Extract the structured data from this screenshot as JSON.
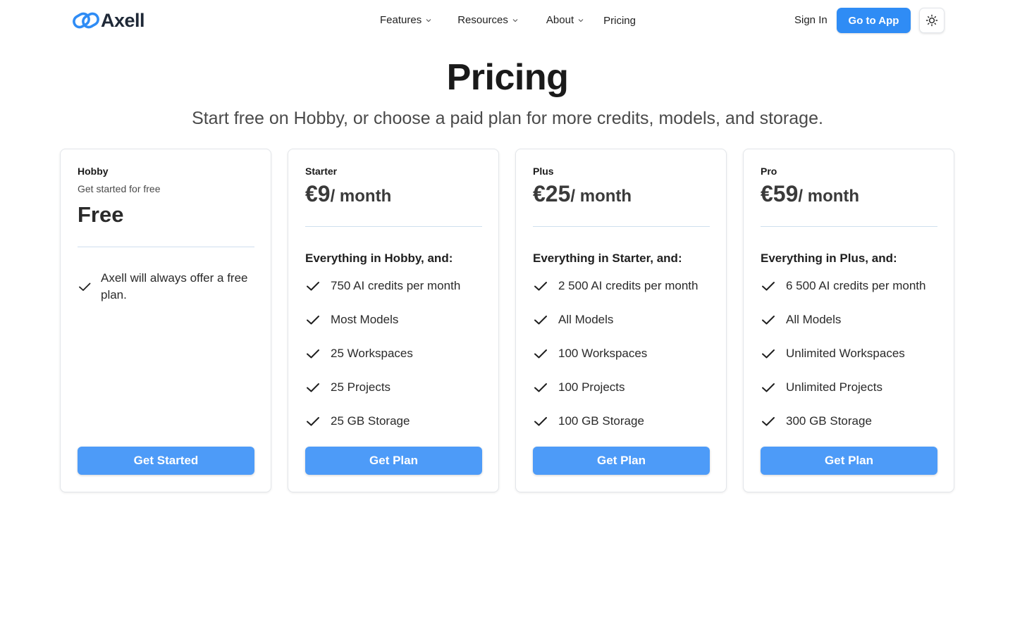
{
  "header": {
    "logo_text": "Axell",
    "logo_icon": "infinity-link-icon",
    "nav": [
      {
        "label": "Features",
        "has_dropdown": true
      },
      {
        "label": "Resources",
        "has_dropdown": true
      },
      {
        "label": "About",
        "has_dropdown": true
      },
      {
        "label": "Pricing",
        "has_dropdown": false
      }
    ],
    "sign_in_label": "Sign In",
    "go_to_app_label": "Go to App",
    "theme_icon": "sun-icon"
  },
  "hero": {
    "title": "Pricing",
    "subtitle": "Start free on Hobby, or choose a paid plan for more credits, models, and storage."
  },
  "plans": [
    {
      "name": "Hobby",
      "tagline": "Get started for free",
      "price_label": "Free",
      "features": [
        "Axell will always offer a free plan."
      ],
      "cta_label": "Get Started"
    },
    {
      "name": "Starter",
      "price_amount": "€9",
      "price_period": "/ month",
      "features_heading": "Everything in Hobby, and:",
      "features": [
        "750 AI credits per month",
        "Most Models",
        "25 Workspaces",
        "25 Projects",
        "25 GB Storage"
      ],
      "cta_label": "Get Plan"
    },
    {
      "name": "Plus",
      "price_amount": "€25",
      "price_period": "/ month",
      "features_heading": "Everything in Starter, and:",
      "features": [
        "2 500 AI credits per month",
        "All Models",
        "100 Workspaces",
        "100 Projects",
        "100 GB Storage"
      ],
      "cta_label": "Get Plan"
    },
    {
      "name": "Pro",
      "price_amount": "€59",
      "price_period": "/ month",
      "features_heading": "Everything in Plus, and:",
      "features": [
        "6 500 AI credits per month",
        "All Models",
        "Unlimited Workspaces",
        "Unlimited Projects",
        "300 GB Storage"
      ],
      "cta_label": "Get Plan"
    }
  ],
  "colors": {
    "primary_button": "#2f8cf5",
    "cta_button": "#4d9bf8",
    "logo_blue": "#2f8cf5",
    "divider": "#cfdfee"
  }
}
